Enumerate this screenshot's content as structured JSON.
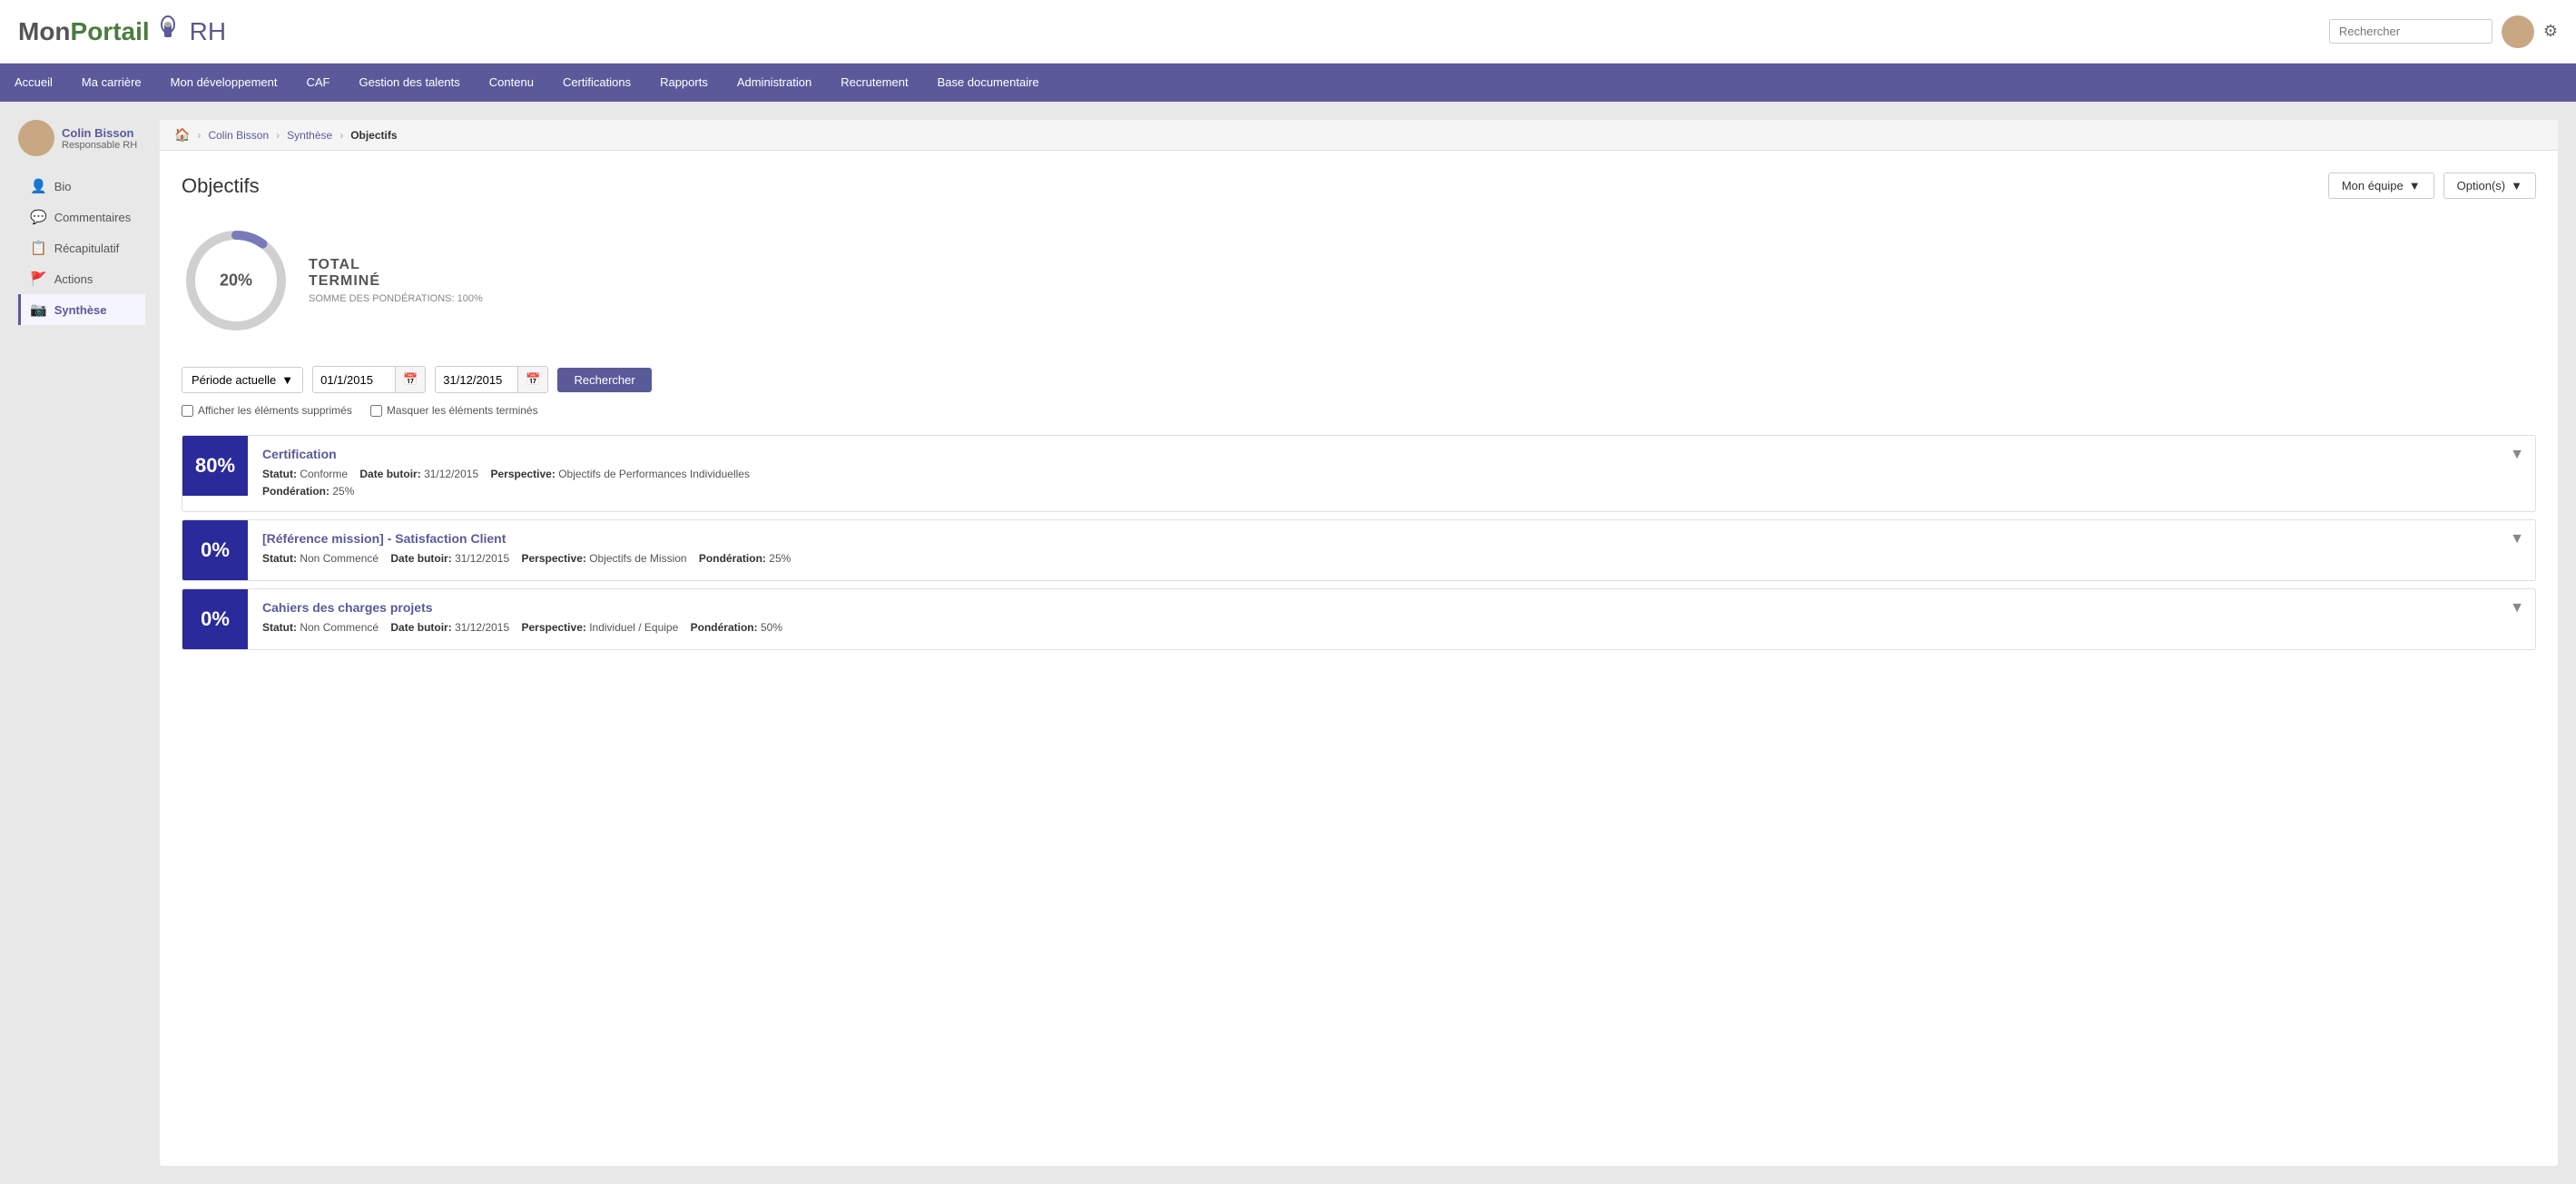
{
  "logo": {
    "mon": "Mon",
    "portail": "Portail",
    "rh": "RH"
  },
  "header": {
    "search_placeholder": "Rechercher",
    "gear_label": "settings"
  },
  "nav": {
    "items": [
      {
        "label": "Accueil",
        "active": false
      },
      {
        "label": "Ma carrière",
        "active": false
      },
      {
        "label": "Mon développement",
        "active": false
      },
      {
        "label": "CAF",
        "active": false
      },
      {
        "label": "Gestion des talents",
        "active": false
      },
      {
        "label": "Contenu",
        "active": false
      },
      {
        "label": "Certifications",
        "active": false
      },
      {
        "label": "Rapports",
        "active": false
      },
      {
        "label": "Administration",
        "active": false
      },
      {
        "label": "Recrutement",
        "active": false
      },
      {
        "label": "Base documentaire",
        "active": false
      }
    ]
  },
  "sidebar": {
    "user": {
      "name": "Colin Bisson",
      "role": "Responsable RH"
    },
    "items": [
      {
        "label": "Bio",
        "icon": "👤",
        "active": false
      },
      {
        "label": "Commentaires",
        "icon": "💬",
        "active": false
      },
      {
        "label": "Récapitulatif",
        "icon": "📋",
        "active": false
      },
      {
        "label": "Actions",
        "icon": "🚩",
        "active": false
      },
      {
        "label": "Synthèse",
        "icon": "📷",
        "active": true
      }
    ]
  },
  "breadcrumb": {
    "home": "🏠",
    "user": "Colin Bisson",
    "section": "Synthèse",
    "current": "Objectifs"
  },
  "page": {
    "title": "Objectifs",
    "btn_mon_equipe": "Mon équipe",
    "btn_options": "Option(s)"
  },
  "chart": {
    "percentage": "20%",
    "total_label": "TOTAL",
    "termine_label": "TERMINÉ",
    "sub_label": "SOMME DES PONDÉRATIONS: 100%",
    "value": 20,
    "bg_color": "#d0d0d0",
    "fill_color": "#7a7aba"
  },
  "filter": {
    "period_label": "Période actuelle",
    "date_from": "01/1/2015",
    "date_to": "31/12/2015",
    "search_label": "Rechercher",
    "cb1_label": "Afficher les éléments supprimés",
    "cb2_label": "Masquer les éléments terminés"
  },
  "objectives": [
    {
      "score": "80%",
      "title": "Certification",
      "statut_label": "Statut:",
      "statut_value": "Conforme",
      "date_label": "Date butoir:",
      "date_value": "31/12/2015",
      "perspective_label": "Perspective:",
      "perspective_value": "Objectifs de Performances Individuelles",
      "ponder_label": "Pondération:",
      "ponder_value": "25%"
    },
    {
      "score": "0%",
      "title": "[Référence mission] - Satisfaction Client",
      "statut_label": "Statut:",
      "statut_value": "Non Commencé",
      "date_label": "Date butoir:",
      "date_value": "31/12/2015",
      "perspective_label": "Perspective:",
      "perspective_value": "Objectifs de Mission",
      "ponder_label": "Pondération:",
      "ponder_value": "25%"
    },
    {
      "score": "0%",
      "title": "Cahiers des charges projets",
      "statut_label": "Statut:",
      "statut_value": "Non Commencé",
      "date_label": "Date butoir:",
      "date_value": "31/12/2015",
      "perspective_label": "Perspective:",
      "perspective_value": "Individuel / Equipe",
      "ponder_label": "Pondération:",
      "ponder_value": "50%"
    }
  ]
}
